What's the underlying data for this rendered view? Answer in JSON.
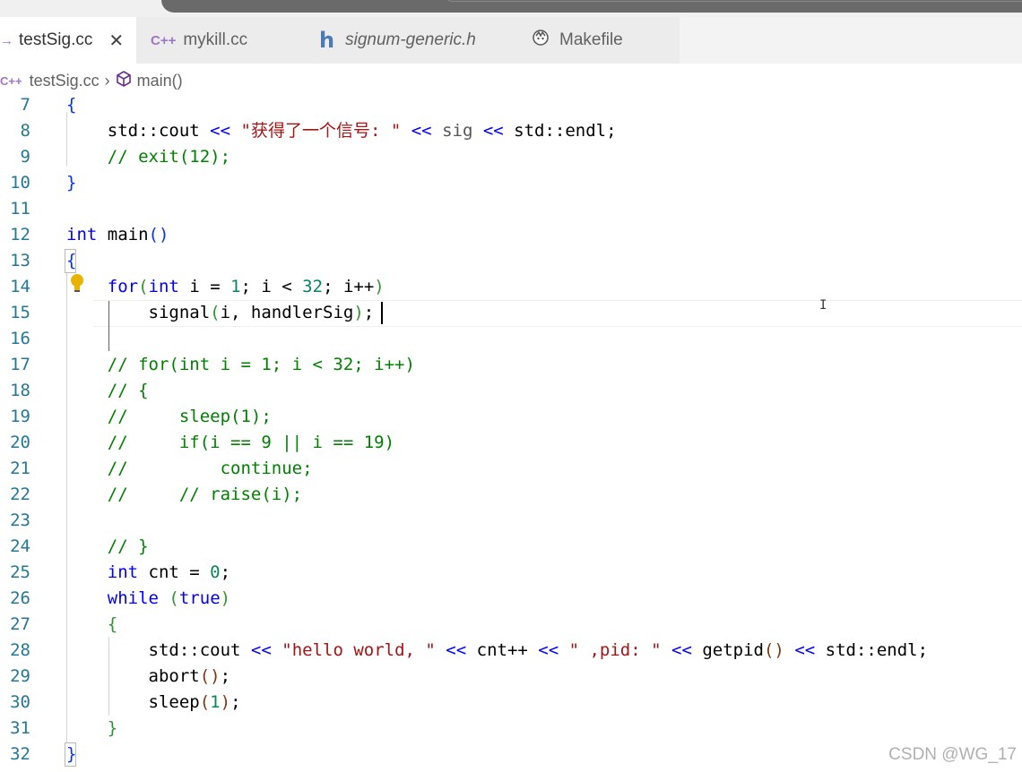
{
  "tabs": [
    {
      "label": "testSig.cc",
      "icon": "arrow-icon"
    },
    {
      "label": "mykill.cc",
      "icon": "cpp-icon"
    },
    {
      "label": "signum-generic.h",
      "icon": "h-file-icon"
    },
    {
      "label": "Makefile",
      "icon": "makefile-icon"
    }
  ],
  "tab_close": "✕",
  "breadcrumb": {
    "file": "testSig.cc",
    "symbol": "main()"
  },
  "editor": {
    "line_numbers": [
      "7",
      "8",
      "9",
      "10",
      "11",
      "12",
      "13",
      "14",
      "15",
      "16",
      "17",
      "18",
      "19",
      "20",
      "21",
      "22",
      "23",
      "24",
      "25",
      "26",
      "27",
      "28",
      "29",
      "30",
      "31",
      "32"
    ]
  },
  "watermark": "CSDN @WG_17",
  "colors": {
    "keyword": "#0000ff",
    "string": "#a31515",
    "number": "#098658",
    "comment": "#008000",
    "line_number": "#237893"
  }
}
